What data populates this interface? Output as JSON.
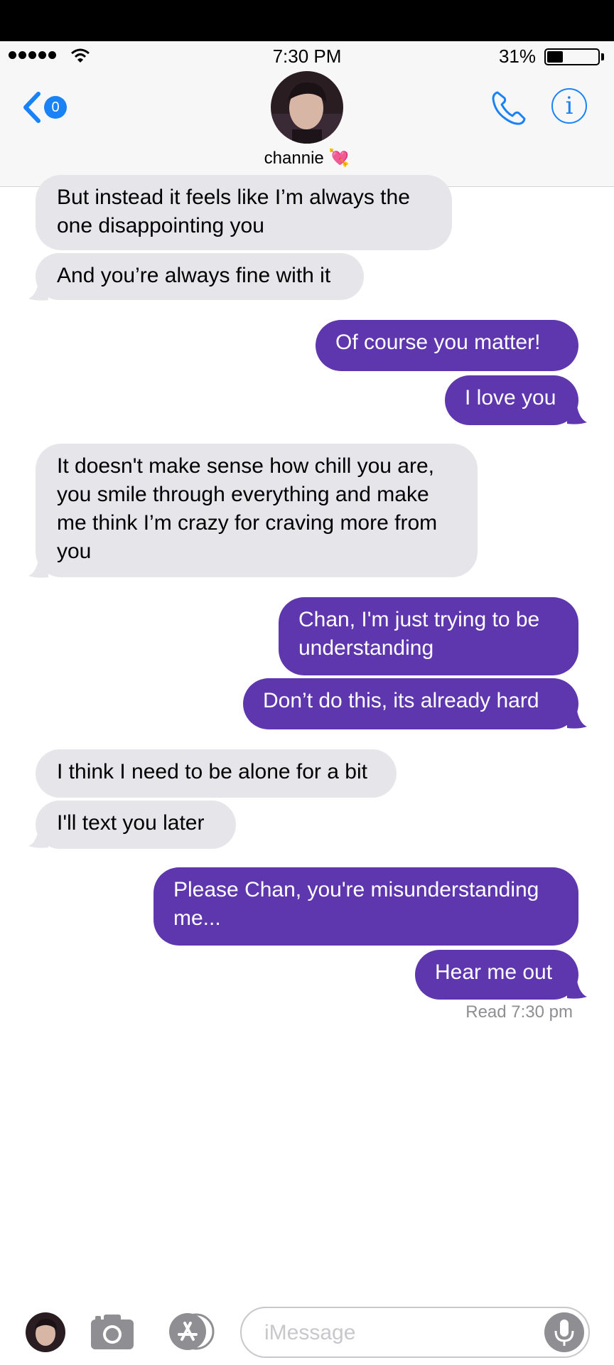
{
  "status_bar": {
    "time": "7:30 PM",
    "battery": "31%",
    "battery_level": 0.31
  },
  "header": {
    "back_badge": "0",
    "contact_name": "channie",
    "contact_emoji": "💘"
  },
  "messages": [
    {
      "dir": "in",
      "text": "But instead it feels like I’m always the\none disappointing you"
    },
    {
      "dir": "in",
      "text": "And you’re always fine with it"
    },
    {
      "dir": "out",
      "text": "Of course you matter!"
    },
    {
      "dir": "out",
      "text": "I love you"
    },
    {
      "dir": "in",
      "text": "It doesn't make sense how chill you are,\nyou smile through everything and make\nme think I’m crazy for craving more from\nyou"
    },
    {
      "dir": "out",
      "text": "Chan, I'm just trying to be\nunderstanding"
    },
    {
      "dir": "out",
      "text": "Don’t do this, its already hard"
    },
    {
      "dir": "in",
      "text": "I think I need to be alone for a bit"
    },
    {
      "dir": "in",
      "text": "I'll text you later"
    },
    {
      "dir": "out",
      "text": "Please Chan, you're misunderstanding\nme..."
    },
    {
      "dir": "out",
      "text": "Hear me out"
    }
  ],
  "read_receipt": "Read 7:30 pm",
  "input": {
    "placeholder": "iMessage",
    "value": ""
  },
  "colors": {
    "outgoing": "#5e37ae",
    "incoming": "#e5e5ea",
    "accent": "#1a82f7"
  }
}
